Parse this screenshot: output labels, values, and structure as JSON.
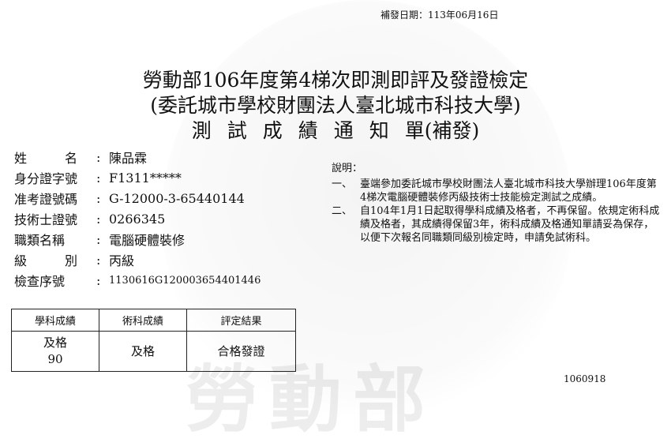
{
  "watermark": "勞動部",
  "reissue_date": "補發日期：113年06月16日",
  "title": {
    "line1": "勞動部106年度第4梯次即測即評及發證檢定",
    "line2": "(委託城市學校財團法人臺北城市科技大學)",
    "line3_chars": [
      "測",
      "試",
      "成",
      "績",
      "通",
      "知",
      "單(補發)"
    ]
  },
  "fields": [
    {
      "label": "姓　　　名",
      "value": "陳品霖"
    },
    {
      "label": "身分證字號",
      "value": "F1311*****"
    },
    {
      "label": "准考證號碼",
      "value": "G-12000-3-65440144"
    },
    {
      "label": "技術士證號",
      "value": "0266345"
    },
    {
      "label": "職類名稱",
      "value": "電腦硬體裝修"
    },
    {
      "label": "級　　　別",
      "value": "丙級"
    },
    {
      "label": "檢查序號",
      "value": "1130616G120003654401446"
    }
  ],
  "notes": {
    "heading": "說明：",
    "items": [
      {
        "num": "一、",
        "text": "臺端參加委託城市學校財團法人臺北城市科技大學辦理106年度第4梯次電腦硬體裝修丙級技術士技能檢定測試之成績。"
      },
      {
        "num": "二、",
        "text": "自104年1月1日起取得學科成績及格者，不再保留。依規定術科成績及格者，其成績得保留3年，術科成績及格通知單請妥為保存，以便下次報名同職類同級別檢定時，申請免試術科。"
      }
    ]
  },
  "grades": {
    "headers": [
      "學科成績",
      "術科成績",
      "評定結果"
    ],
    "written": {
      "status": "及格",
      "score": "90"
    },
    "practical": "及格",
    "result": "合格發證"
  },
  "serial": "1060918"
}
